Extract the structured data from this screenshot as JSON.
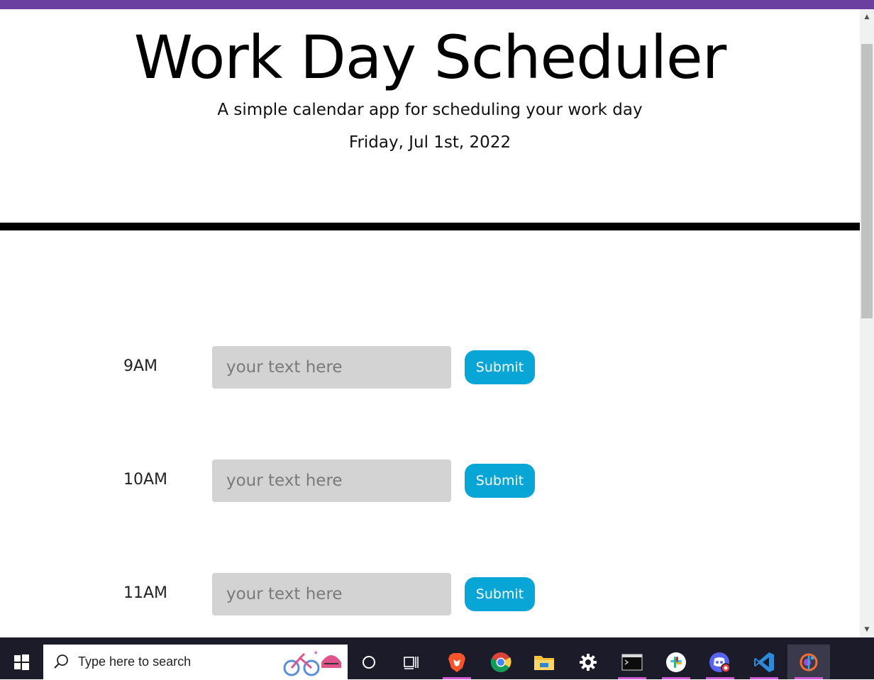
{
  "header": {
    "title": "Work Day Scheduler",
    "subtitle": "A simple calendar app for scheduling your work day",
    "date": "Friday, Jul 1st, 2022"
  },
  "schedule": {
    "rows": [
      {
        "hour": "9AM",
        "placeholder": "your text here",
        "value": "",
        "submit_label": "Submit"
      },
      {
        "hour": "10AM",
        "placeholder": "your text here",
        "value": "",
        "submit_label": "Submit"
      },
      {
        "hour": "11AM",
        "placeholder": "your text here",
        "value": "",
        "submit_label": "Submit"
      }
    ]
  },
  "taskbar": {
    "search_placeholder": "Type here to search",
    "apps": [
      {
        "name": "brave-icon"
      },
      {
        "name": "chrome-icon"
      },
      {
        "name": "file-explorer-icon"
      },
      {
        "name": "settings-gear-icon"
      },
      {
        "name": "terminal-icon"
      },
      {
        "name": "slack-icon"
      },
      {
        "name": "discord-icon"
      },
      {
        "name": "vscode-icon"
      },
      {
        "name": "git-app-icon"
      }
    ]
  },
  "colors": {
    "accent_strip": "#6b3fa0",
    "submit_button": "#08a6d6",
    "input_background": "#d3d3d3",
    "divider": "#000000"
  }
}
